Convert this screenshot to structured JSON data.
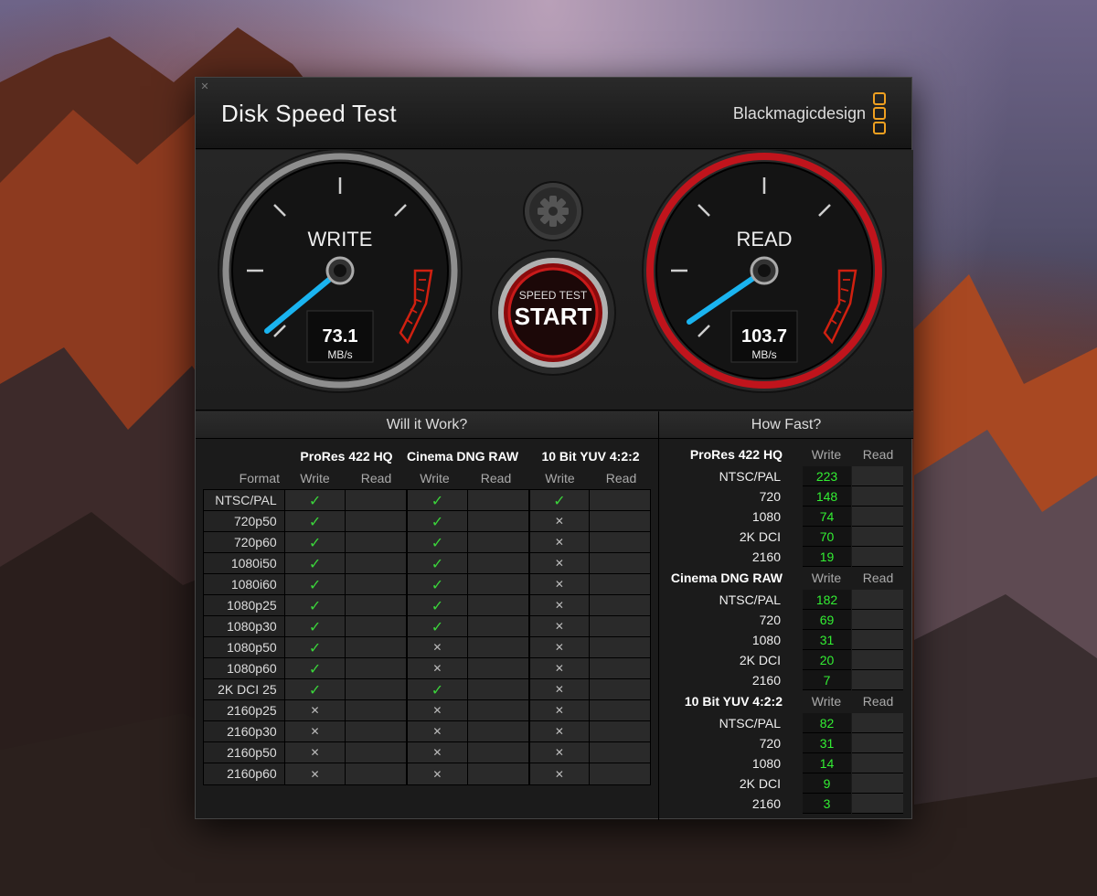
{
  "app": {
    "title": "Disk Speed Test",
    "brand": "Blackmagicdesign"
  },
  "gauges": {
    "write": {
      "label": "WRITE",
      "value": "73.1",
      "unit": "MB/s"
    },
    "read": {
      "label": "READ",
      "value": "103.7",
      "unit": "MB/s"
    }
  },
  "start_button": {
    "top": "SPEED TEST",
    "main": "START"
  },
  "will_it_work": {
    "title": "Will it Work?",
    "format_label": "Format",
    "groups": [
      "ProRes 422 HQ",
      "Cinema DNG RAW",
      "10 Bit YUV 4:2:2"
    ],
    "write_label": "Write",
    "read_label": "Read",
    "rows": [
      {
        "format": "NTSC/PAL",
        "prores": true,
        "dng": true,
        "yuv": true
      },
      {
        "format": "720p50",
        "prores": true,
        "dng": true,
        "yuv": false
      },
      {
        "format": "720p60",
        "prores": true,
        "dng": true,
        "yuv": false
      },
      {
        "format": "1080i50",
        "prores": true,
        "dng": true,
        "yuv": false
      },
      {
        "format": "1080i60",
        "prores": true,
        "dng": true,
        "yuv": false
      },
      {
        "format": "1080p25",
        "prores": true,
        "dng": true,
        "yuv": false
      },
      {
        "format": "1080p30",
        "prores": true,
        "dng": true,
        "yuv": false
      },
      {
        "format": "1080p50",
        "prores": true,
        "dng": false,
        "yuv": false
      },
      {
        "format": "1080p60",
        "prores": true,
        "dng": false,
        "yuv": false
      },
      {
        "format": "2K DCI 25",
        "prores": true,
        "dng": true,
        "yuv": false
      },
      {
        "format": "2160p25",
        "prores": false,
        "dng": false,
        "yuv": false
      },
      {
        "format": "2160p30",
        "prores": false,
        "dng": false,
        "yuv": false
      },
      {
        "format": "2160p50",
        "prores": false,
        "dng": false,
        "yuv": false
      },
      {
        "format": "2160p60",
        "prores": false,
        "dng": false,
        "yuv": false
      }
    ]
  },
  "how_fast": {
    "title": "How Fast?",
    "write_label": "Write",
    "read_label": "Read",
    "groups": [
      {
        "name": "ProRes 422 HQ",
        "rows": [
          {
            "format": "NTSC/PAL",
            "write": "223"
          },
          {
            "format": "720",
            "write": "148"
          },
          {
            "format": "1080",
            "write": "74"
          },
          {
            "format": "2K DCI",
            "write": "70"
          },
          {
            "format": "2160",
            "write": "19"
          }
        ]
      },
      {
        "name": "Cinema DNG RAW",
        "rows": [
          {
            "format": "NTSC/PAL",
            "write": "182"
          },
          {
            "format": "720",
            "write": "69"
          },
          {
            "format": "1080",
            "write": "31"
          },
          {
            "format": "2K DCI",
            "write": "20"
          },
          {
            "format": "2160",
            "write": "7"
          }
        ]
      },
      {
        "name": "10 Bit YUV 4:2:2",
        "rows": [
          {
            "format": "NTSC/PAL",
            "write": "82"
          },
          {
            "format": "720",
            "write": "31"
          },
          {
            "format": "1080",
            "write": "14"
          },
          {
            "format": "2K DCI",
            "write": "9"
          },
          {
            "format": "2160",
            "write": "3"
          }
        ]
      }
    ]
  },
  "icons": {
    "settings": "gear-icon",
    "close": "close-icon",
    "pass": "checkmark-icon",
    "fail": "cross-icon"
  },
  "colors": {
    "accent": "#f0a020",
    "pass": "#3bd43b",
    "value": "#33ee33",
    "needle": "#1ab4f0",
    "read_ring": "#c0141c"
  }
}
